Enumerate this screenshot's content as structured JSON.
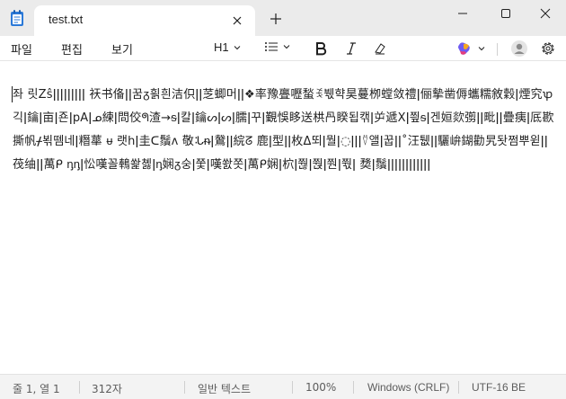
{
  "tab": {
    "title": "test.txt"
  },
  "menu": {
    "file": "파일",
    "edit": "편집",
    "view": "보기"
  },
  "toolbar": {
    "heading": "H1"
  },
  "editor": {
    "text": "좌 릿Zŝǀǀǀǀǀǀǀǀǀ 祆书俻ǀǀ꿈ᵹ흵흰洁伿ǀǀ䒦蝍머ǀǀ❖率豫亹嚦蝵ꉂ붻햑昊蔓栁螳敛禮ǀ俪摰凿傉蠵糯敘穀ǀ煙究ꝕ긱ǀ鑰ǀ亩ǀ죤ǀpAǀᓄ練ǀ問佼ᖗ渣→ᵴǀ칼ǀ鑰ᔕǀᔕǀ臑ǀ꾸ǀ覲悞眵送栱冎睽됩캒ǀ屰遞Xǀ찊ᵴǀ겐姮欻彅ǀǀ毗ǀǀ疊痍ǀ厎歁撕帆ᚋ뵊뗌네ǀ糣蕐 ᵾ 랫hǀ圭ᑕ鬚ʌ 敬ᒠᵰǀ䳣ǀǀ綄ᘔ 鹿ǀ型ǀǀ枚Δ뙤ǀ뭘ǀ◌ǀǀǀ⍢앨ǀ꿉ǀǀ˚汪퉶ǀǀ驪峅鍸勸旯돳쩜뿌윋ǀǀ茷䌷ǀǀ萬ᑭ ᶇᶇǀ忪嘆꼴䳞쐁쳻ǀᶇ娴ᵹ숭ǀ쭟ǀ嘆쐀쫏ǀ萬ᑭ娴ǀ柼ǀ쭪ǀ쭩ǀ쭨ǀ쭧ǀ 奦ǀ鬚ǀǀǀǀǀǀǀǀǀǀǀǀ"
  },
  "status": {
    "position": "줄 1, 열 1",
    "char_count": "312자",
    "format": "일반 텍스트",
    "zoom": "100%",
    "line_ending": "Windows (CRLF)",
    "encoding": "UTF-16 BE"
  }
}
